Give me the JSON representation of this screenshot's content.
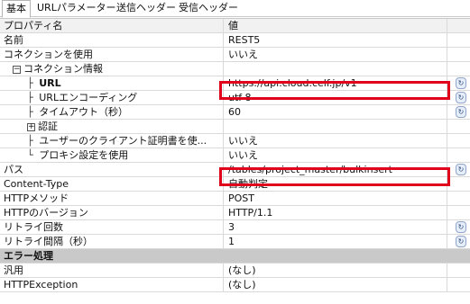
{
  "tabs": [
    "基本",
    "URLパラメーター",
    "送信ヘッダー",
    "受信ヘッダー"
  ],
  "grid": {
    "header": {
      "name": "プロパティ名",
      "value": "値"
    },
    "rows": [
      {
        "name": "名前",
        "value": "REST5"
      },
      {
        "name": "コネクションを使用",
        "value": "いいえ"
      },
      {
        "name": "コネクション情報",
        "value": ""
      },
      {
        "name": "URL",
        "value": "https://api.cloud.celf.jp/v1"
      },
      {
        "name": "URLエンコーディング",
        "value": "utf-8"
      },
      {
        "name": "タイムアウト（秒）",
        "value": "60"
      },
      {
        "name": "認証",
        "value": ""
      },
      {
        "name": "ユーザーのクライアント証明書を使...",
        "value": "いいえ"
      },
      {
        "name": "プロキシ設定を使用",
        "value": "いいえ"
      },
      {
        "name": "パス",
        "value": "/tables/project_master/bulkinsert"
      },
      {
        "name": "Content-Type",
        "value": "自動判定"
      },
      {
        "name": "HTTPメソッド",
        "value": "POST"
      },
      {
        "name": "HTTPのバージョン",
        "value": "HTTP/1.1"
      },
      {
        "name": "リトライ回数",
        "value": "3"
      },
      {
        "name": "リトライ間隔（秒）",
        "value": "1"
      },
      {
        "name": "エラー処理",
        "value": ""
      },
      {
        "name": "汎用",
        "value": "(なし)"
      },
      {
        "name": "HTTPException",
        "value": "(なし)"
      }
    ]
  }
}
